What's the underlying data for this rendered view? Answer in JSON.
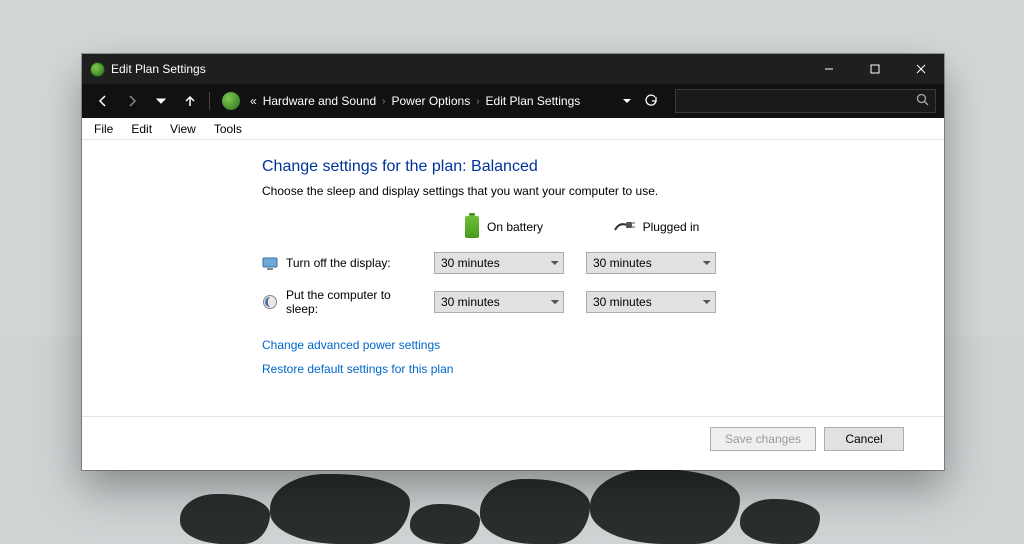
{
  "window": {
    "title": "Edit Plan Settings"
  },
  "breadcrumb": {
    "prefix": "«",
    "items": [
      "Hardware and Sound",
      "Power Options",
      "Edit Plan Settings"
    ]
  },
  "menu": {
    "items": [
      "File",
      "Edit",
      "View",
      "Tools"
    ]
  },
  "page": {
    "heading": "Change settings for the plan: Balanced",
    "subheading": "Choose the sleep and display settings that you want your computer to use.",
    "columns": {
      "battery": "On battery",
      "plugged": "Plugged in"
    },
    "rows": {
      "display": {
        "label": "Turn off the display:",
        "battery_value": "30 minutes",
        "plugged_value": "30 minutes"
      },
      "sleep": {
        "label": "Put the computer to sleep:",
        "battery_value": "30 minutes",
        "plugged_value": "30 minutes"
      }
    },
    "links": {
      "advanced": "Change advanced power settings",
      "restore": "Restore default settings for this plan"
    },
    "buttons": {
      "save": "Save changes",
      "cancel": "Cancel"
    }
  }
}
